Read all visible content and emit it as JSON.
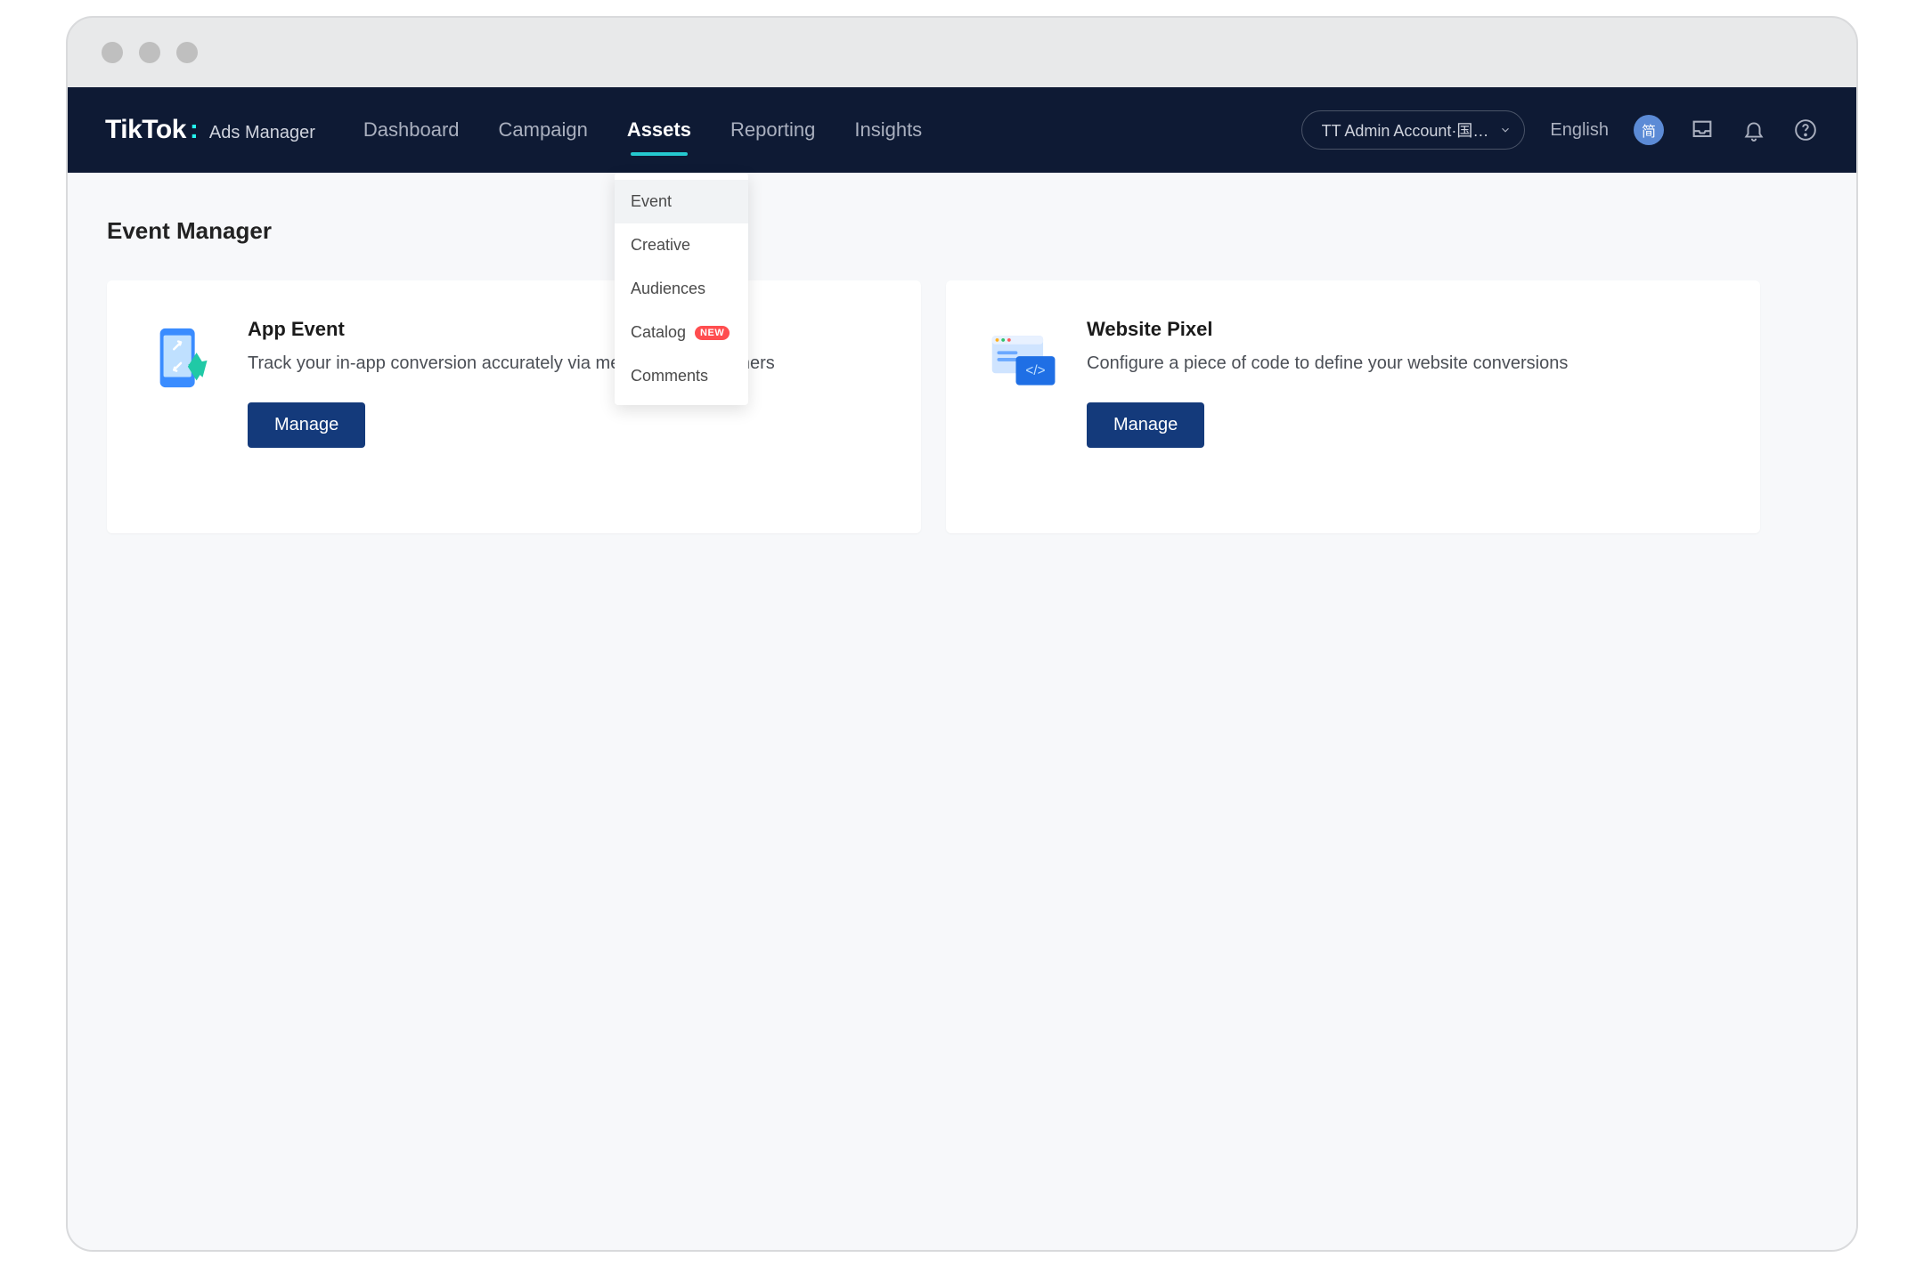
{
  "brand": {
    "name": "TikTok",
    "product": "Ads Manager"
  },
  "nav": {
    "items": [
      "Dashboard",
      "Campaign",
      "Assets",
      "Reporting",
      "Insights"
    ],
    "active_index": 2
  },
  "account_selector": {
    "label": "TT Admin Account·国…"
  },
  "language": "English",
  "avatar_label": "简",
  "assets_dropdown": {
    "items": [
      {
        "label": "Event",
        "hover": true
      },
      {
        "label": "Creative"
      },
      {
        "label": "Audiences"
      },
      {
        "label": "Catalog",
        "badge": "NEW"
      },
      {
        "label": "Comments"
      }
    ]
  },
  "page": {
    "title": "Event Manager"
  },
  "cards": [
    {
      "icon": "app-event-icon",
      "title": "App Event",
      "desc": "Track your in-app conversion accurately via measurement partners",
      "cta": "Manage"
    },
    {
      "icon": "website-pixel-icon",
      "title": "Website Pixel",
      "desc": "Configure a piece of code to define your website conversions",
      "cta": "Manage"
    }
  ],
  "colors": {
    "nav_bg": "#0e1a34",
    "accent_underline": "#25c9d0",
    "button_primary": "#143a7b",
    "badge_new": "#ff4d4f"
  }
}
